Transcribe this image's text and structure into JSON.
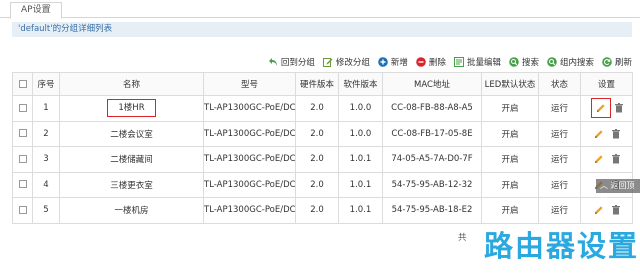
{
  "tab": {
    "label": "AP设置"
  },
  "group_bar": {
    "text": "'default'的分组详细列表"
  },
  "toolbar": {
    "back_label": "回到分组",
    "modify_label": "修改分组",
    "add_label": "新增",
    "delete_label": "删除",
    "batch_label": "批量编辑",
    "search_label": "搜索",
    "group_search_label": "组内搜索",
    "refresh_label": "刷新"
  },
  "columns": [
    "序号",
    "名称",
    "型号",
    "硬件版本",
    "软件版本",
    "MAC地址",
    "LED默认状态",
    "状态",
    "设置"
  ],
  "rows": [
    {
      "no": "1",
      "name": "1楼HR",
      "model": "TL-AP1300GC-PoE/DC",
      "hw": "2.0",
      "sw": "1.0.0",
      "mac": "CC-08-FB-88-A8-A5",
      "led": "开启",
      "status": "运行"
    },
    {
      "no": "2",
      "name": "二楼会议室",
      "model": "TL-AP1300GC-PoE/DC",
      "hw": "2.0",
      "sw": "1.0.0",
      "mac": "CC-08-FB-17-05-8E",
      "led": "开启",
      "status": "运行"
    },
    {
      "no": "3",
      "name": "二楼储藏间",
      "model": "TL-AP1300GC-PoE/DC",
      "hw": "2.0",
      "sw": "1.0.1",
      "mac": "74-05-A5-7A-D0-7F",
      "led": "开启",
      "status": "运行"
    },
    {
      "no": "4",
      "name": "三楼更衣室",
      "model": "TL-AP1300GC-PoE/DC",
      "hw": "2.0",
      "sw": "1.0.1",
      "mac": "54-75-95-AB-12-32",
      "led": "开启",
      "status": "运行"
    },
    {
      "no": "5",
      "name": "一楼机房",
      "model": "TL-AP1300GC-PoE/DC",
      "hw": "2.0",
      "sw": "1.0.1",
      "mac": "54-75-95-AB-18-E2",
      "led": "开启",
      "status": "运行"
    }
  ],
  "pager": {
    "text": "共"
  },
  "back_top": {
    "label": "返回顶部"
  },
  "watermark": {
    "text": "路由器设置"
  },
  "icons": {
    "back": "undo-arrow-icon",
    "modify": "edit-group-icon",
    "add": "plus-circle-icon",
    "delete": "minus-circle-icon",
    "batch": "batch-edit-icon",
    "search": "search-icon",
    "group_search": "search-icon",
    "refresh": "refresh-icon",
    "edit": "pencil-icon",
    "trash": "trash-icon"
  },
  "colors": {
    "accent": "#3a6ea5",
    "highlight": "#d9262d",
    "add_green": "#2e9e4a",
    "delete_red": "#d9262d",
    "watermark": "#2aa8e0"
  }
}
